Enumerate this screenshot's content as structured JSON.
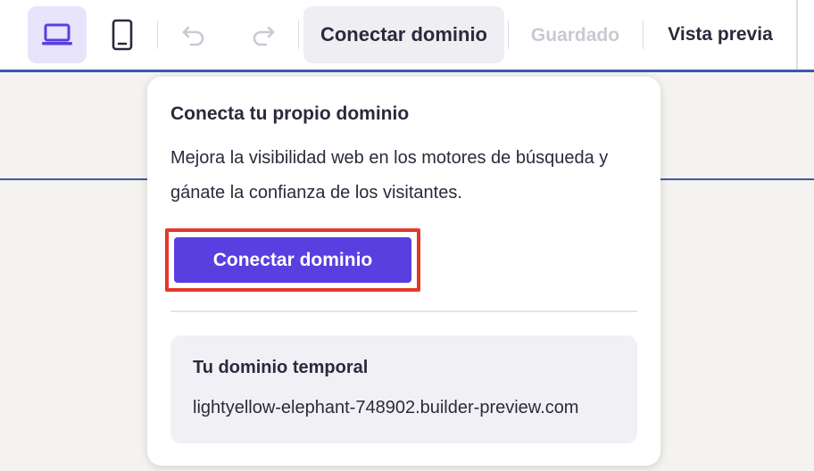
{
  "toolbar": {
    "connect_label": "Conectar dominio",
    "saved_label": "Guardado",
    "preview_label": "Vista previa",
    "icons": {
      "desktop": "laptop-icon",
      "mobile": "mobile-icon",
      "undo": "undo-icon",
      "redo": "redo-icon"
    }
  },
  "popover": {
    "title": "Conecta tu propio dominio",
    "description": "Mejora la visibilidad web en los motores de búsqueda y gánate la confianza de los visitantes.",
    "cta_label": "Conectar dominio",
    "temp_domain": {
      "title": "Tu dominio temporal",
      "url": "lightyellow-elephant-748902.builder-preview.com"
    }
  },
  "colors": {
    "accent": "#5a3fe0",
    "highlight_frame": "#e2382a",
    "rule_blue": "#3a5bab",
    "page_bg": "#f4f3ef"
  }
}
